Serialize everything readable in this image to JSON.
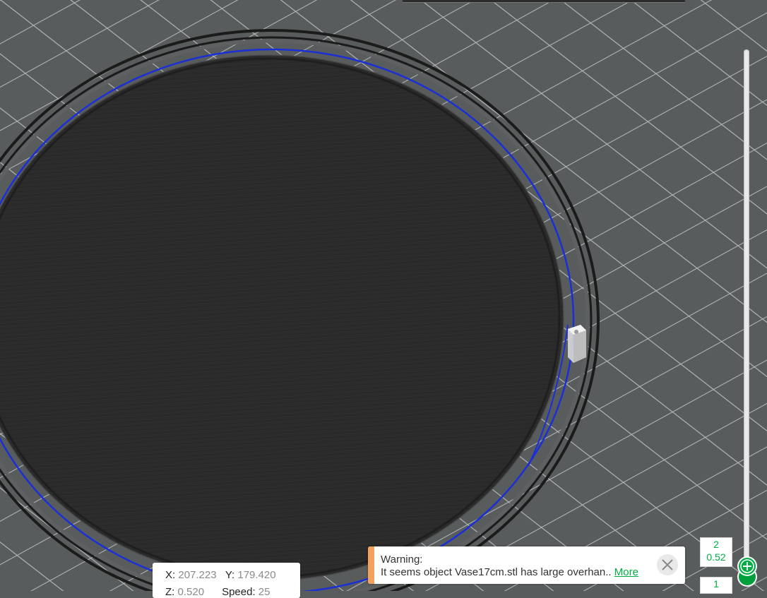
{
  "colors": {
    "background": "#595c5d",
    "grid_line": "#b4b8b9",
    "plate_ring": "#1b1b1b",
    "blue_outline": "#1b2fd6",
    "layer_fill": "#2c2c2c",
    "accent_green": "#00ae42",
    "warning_accent": "#f2a25c"
  },
  "layer_slider": {
    "upper_layer": "2",
    "upper_height": "0.52",
    "lower_layer": "1"
  },
  "coords": {
    "x_label": "X:",
    "x_value": "207.223",
    "y_label": "Y:",
    "y_value": "179.420",
    "z_label": "Z:",
    "z_value": "0.520",
    "speed_label": "Speed:",
    "speed_value": "25"
  },
  "warning": {
    "title": "Warning:",
    "message": "It seems object Vase17cm.stl has large overhan..",
    "more_label": "More",
    "close_icon": "close-icon"
  },
  "tool_marker_icon": "toolhead-marker-icon"
}
